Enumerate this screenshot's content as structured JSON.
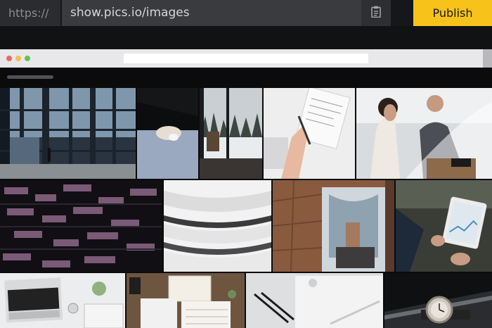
{
  "publish_bar": {
    "protocol": "https://",
    "url": "show.pics.io/images",
    "copy_icon": "clipboard-icon",
    "publish_label": "Publish",
    "accent": "#f7c21a"
  },
  "browser": {
    "controls": [
      "close",
      "minimize",
      "zoom"
    ],
    "control_colors": [
      "#ee6a5e",
      "#f5be4f",
      "#61c554"
    ]
  },
  "gallery": {
    "images": [
      {
        "subject": "glass office building atrium"
      },
      {
        "subject": "hand on computer mouse"
      },
      {
        "subject": "snowy pine forest through windows"
      },
      {
        "subject": "hand writing in notebook at keyboard"
      },
      {
        "subject": "two colleagues working at laptop"
      },
      {
        "subject": "office building at night"
      },
      {
        "subject": "white curved architecture"
      },
      {
        "subject": "brick interior with atrium"
      },
      {
        "subject": "hands holding tablet with charts"
      },
      {
        "subject": "desk with laptop and plant"
      },
      {
        "subject": "desk with notebooks and calendar"
      },
      {
        "subject": "white laptop with pencils"
      },
      {
        "subject": "wristwatch on dark surface"
      }
    ]
  }
}
